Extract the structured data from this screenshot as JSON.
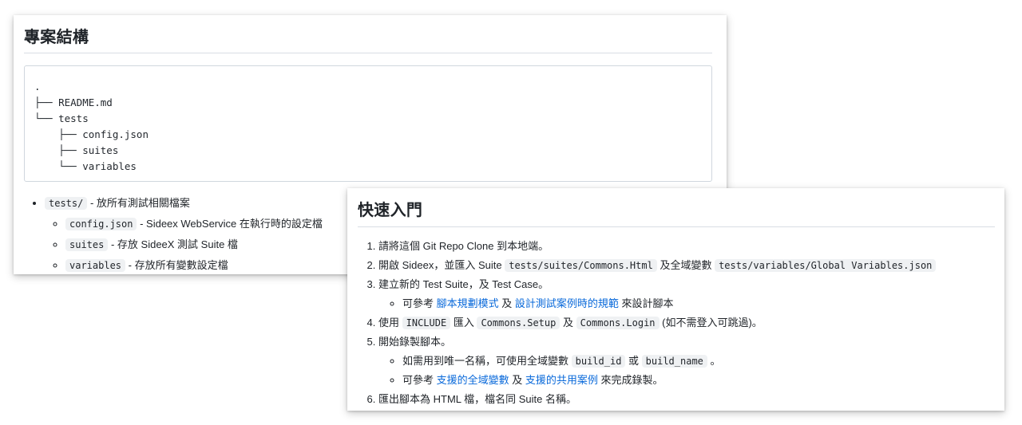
{
  "structure": {
    "title": "專案結構",
    "tree_lines": [
      ".",
      "├── README.md",
      "└── tests",
      "    ├── config.json",
      "    ├── suites",
      "    └── variables"
    ],
    "bullet": {
      "code": "tests/",
      "text": " - 放所有測試相關檔案",
      "children": [
        {
          "code": "config.json",
          "text": " - Sideex WebService 在執行時的設定檔"
        },
        {
          "code": "suites",
          "text": " - 存放 SideeX 測試 Suite 檔"
        },
        {
          "code": "variables",
          "text": " - 存放所有變數設定檔"
        }
      ]
    }
  },
  "quickstart": {
    "title": "快速入門",
    "step1": "請將這個 Git Repo Clone 到本地端。",
    "step2": {
      "t1": "開啟 Sideex，並匯入 Suite ",
      "c1": "tests/suites/Commons.Html",
      "t2": " 及全域變數 ",
      "c2": "tests/variables/Global Variables.json"
    },
    "step3": {
      "text": "建立新的 Test Suite，及 Test Case。",
      "sub": {
        "t1": "可參考 ",
        "l1": "腳本規劃模式",
        "t2": " 及 ",
        "l2": "設計測試案例時的規範",
        "t3": " 來設計腳本"
      }
    },
    "step4": {
      "t1": "使用 ",
      "c1": "INCLUDE",
      "t2": " 匯入 ",
      "c2": "Commons.Setup",
      "t3": " 及 ",
      "c3": "Commons.Login",
      "t4": " (如不需登入可跳過)。"
    },
    "step5": {
      "text": "開始錄製腳本。",
      "sub1": {
        "t1": "如需用到唯一名稱，可使用全域變數 ",
        "c1": "build_id",
        "t2": " 或 ",
        "c2": "build_name",
        "t3": " 。"
      },
      "sub2": {
        "t1": "可參考 ",
        "l1": "支援的全域變數",
        "t2": " 及 ",
        "l2": "支援的共用案例",
        "t3": " 來完成錄製。"
      }
    },
    "step6": "匯出腳本為 HTML 檔，檔名同 Suite 名稱。"
  },
  "colors": {
    "link": "#0969da",
    "code_bg": "#eff1f3",
    "border": "#d0d7de"
  }
}
